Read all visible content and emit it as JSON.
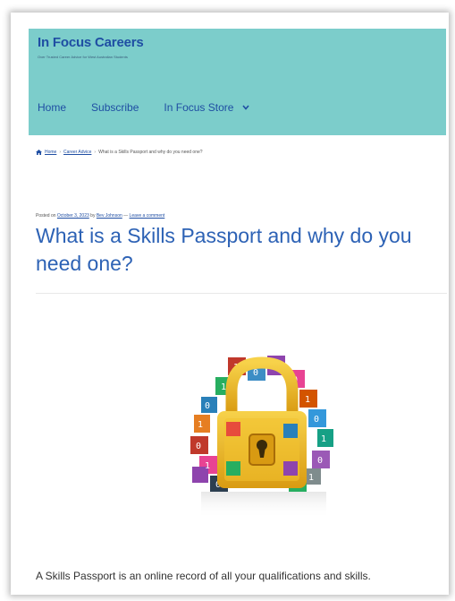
{
  "header": {
    "site_title": "In Focus Careers",
    "tagline": "Over Trusted Career Advice for West Australian Students",
    "nav": [
      {
        "label": "Home"
      },
      {
        "label": "Subscribe"
      },
      {
        "label": "In Focus Store"
      }
    ]
  },
  "breadcrumb": {
    "items": [
      "Home",
      "Career Advice"
    ],
    "current": "What is a Skills Passport and why do you need one?",
    "separator": "›"
  },
  "post": {
    "meta": {
      "posted_on": "Posted on",
      "date": "October 3, 2023",
      "by": "by",
      "author": "Bev Johnson",
      "dash": "—",
      "comment_link": "Leave a comment"
    },
    "title": "What is a Skills Passport and why do you need one?",
    "image_icon": "padlock-binary-cubes-illustration",
    "lead": "A Skills Passport is an online record of all your qualifications and skills."
  },
  "colors": {
    "masthead_bg": "#7ccdcb",
    "brand_blue": "#1f4ea3",
    "title_blue": "#2d62b5",
    "padlock_gold": "#e8b520"
  }
}
